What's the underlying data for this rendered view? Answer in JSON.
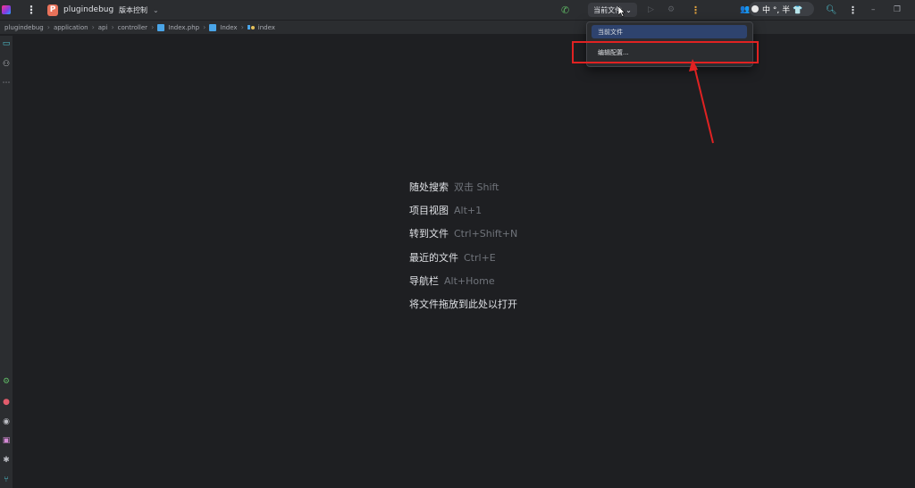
{
  "titlebar": {
    "project_badge": "P",
    "project_name": "plugindebug",
    "vcs_label": "版本控制",
    "run_config": "当前文件",
    "ime": "中 °, 半 👕"
  },
  "breadcrumb": [
    "plugindebug",
    "application",
    "api",
    "controller",
    "Index.php",
    "Index",
    "index"
  ],
  "dropdown": {
    "items": [
      "当前文件",
      "编辑配置..."
    ]
  },
  "hints": [
    {
      "label": "随处搜索",
      "key": "双击 Shift"
    },
    {
      "label": "项目视图",
      "key": "Alt+1"
    },
    {
      "label": "转到文件",
      "key": "Ctrl+Shift+N"
    },
    {
      "label": "最近的文件",
      "key": "Ctrl+E"
    },
    {
      "label": "导航栏",
      "key": "Alt+Home"
    },
    {
      "label": "将文件拖放到此处以打开",
      "key": ""
    }
  ],
  "icons": {
    "logo": "jetbrains-logo-icon",
    "menu": "main-menu-icon",
    "phone": "code-with-me-icon",
    "run": "run-icon",
    "debug": "debug-icon",
    "more": "more-actions-icon",
    "collab": "collaboration-icon",
    "search": "search-icon",
    "settings": "settings-icon",
    "minimize": "minimize-icon",
    "restore": "restore-icon"
  },
  "colors": {
    "background": "#1e1f22",
    "panel": "#2b2d30",
    "selection": "#2e436e",
    "annotation": "#e02222"
  }
}
